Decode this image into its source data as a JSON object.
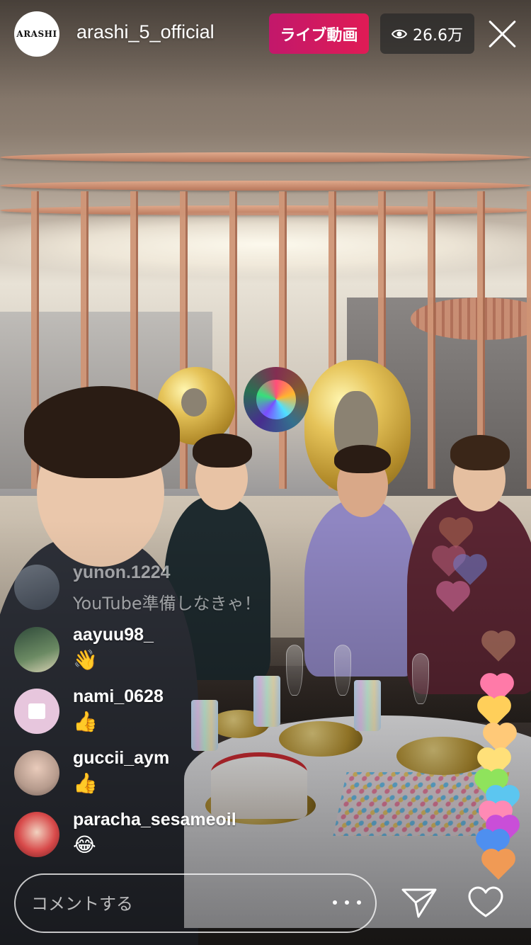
{
  "header": {
    "channel_logo_text": "ARASHI",
    "username": "arashi_5_official",
    "live_label": "ライブ動画",
    "viewer_count": "26.6万"
  },
  "comments": [
    {
      "user": "yunon.1224",
      "text": "YouTube準備しなきゃ！"
    },
    {
      "user": "aayuu98_",
      "text": "👋"
    },
    {
      "user": "nami_0628",
      "text": "👍"
    },
    {
      "user": "guccii_aym",
      "text": "👍"
    },
    {
      "user": "paracha_sesameoil",
      "text": "😂"
    }
  ],
  "footer": {
    "comment_placeholder": "コメントする"
  },
  "colors": {
    "live_badge": "#d51a5f",
    "viewer_badge_bg": "#2e2e2e"
  },
  "icons": [
    "eye-icon",
    "close-icon",
    "more-icon",
    "send-icon",
    "heart-icon"
  ]
}
